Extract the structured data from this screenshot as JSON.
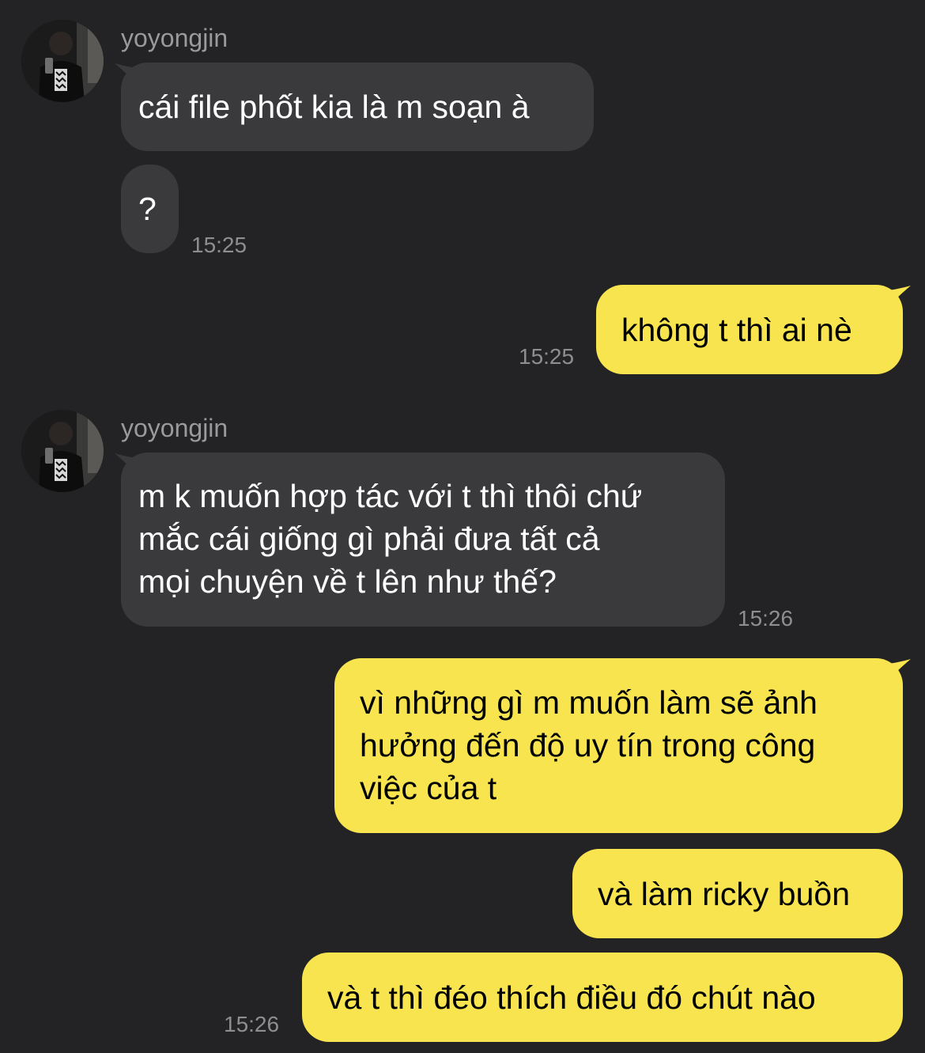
{
  "conversation": {
    "contact_name": "yoyongjin",
    "messages": [
      {
        "id": "m1",
        "from": "contact",
        "text": "cái file phốt kia là m soạn à"
      },
      {
        "id": "m2",
        "from": "contact",
        "text": "?",
        "time": "15:25"
      },
      {
        "id": "m3",
        "from": "me",
        "text": "không t thì ai nè",
        "time": "15:25"
      },
      {
        "id": "m4",
        "from": "contact",
        "lines": [
          "m k muốn hợp tác với t thì thôi chứ",
          "mắc cái giống gì phải đưa tất cả",
          "mọi chuyện về t lên như thế?"
        ],
        "time": "15:26"
      },
      {
        "id": "m5",
        "from": "me",
        "lines": [
          "vì những gì m muốn làm sẽ ảnh",
          "hưởng đến độ uy tín trong công",
          "việc của t"
        ]
      },
      {
        "id": "m6",
        "from": "me",
        "text": "và làm ricky buồn"
      },
      {
        "id": "m7",
        "from": "me",
        "text": "và t thì đéo thích điều đó chút nào",
        "time": "15:26"
      }
    ]
  },
  "theme": {
    "background": "#232325",
    "incoming_bubble": "#3a3a3c",
    "outgoing_bubble": "#f7e44f",
    "name_color": "#9a9a9a",
    "time_color": "#8e8e8e",
    "avatar_icon": "profile-photo"
  }
}
